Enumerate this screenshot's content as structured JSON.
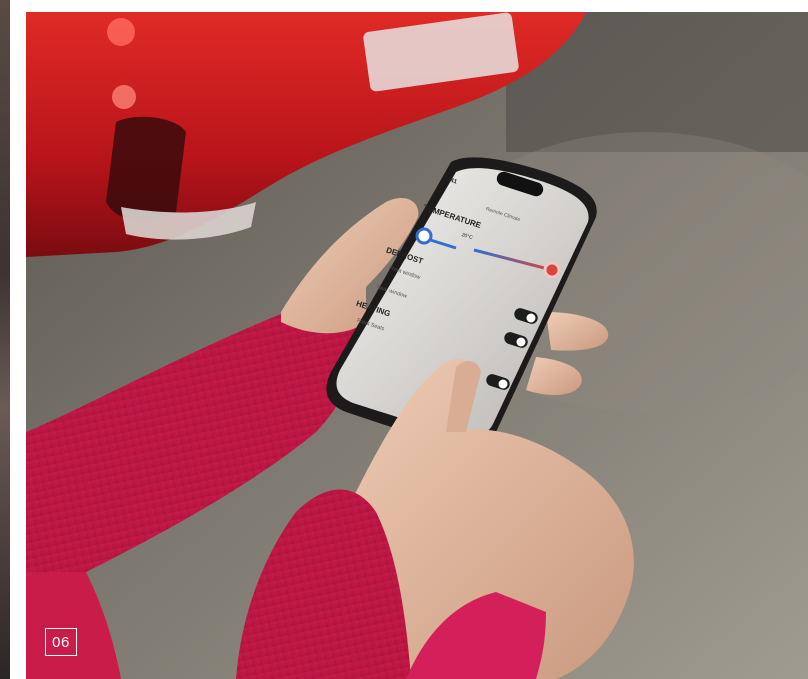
{
  "badge": {
    "number": "06"
  },
  "phone": {
    "status_time": "9:41",
    "header_title": "Remote Climate",
    "temperature_heading": "TEMPERATURE",
    "temperature_value": "20°C",
    "defrost_heading": "DEFROST",
    "defrost_items": [
      "Front window",
      "Rear window"
    ],
    "heating_heading": "HEATING",
    "heating_items": [
      "Front Seats"
    ]
  },
  "colors": {
    "car_red": "#d0141b",
    "sweater_pink": "#e0245a",
    "accent_blue": "#2f6fd1",
    "accent_red": "#d9463f"
  }
}
